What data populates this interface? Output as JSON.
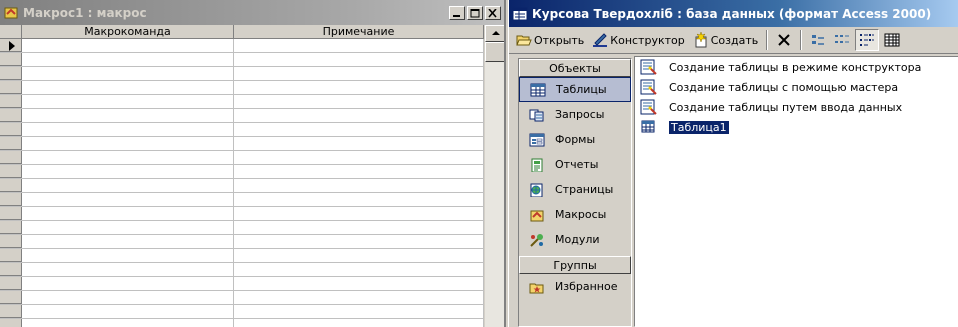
{
  "macro_window": {
    "title": "Макрос1 : макрос",
    "columns": [
      "Макрокоманда",
      "Примечание"
    ],
    "row_count": 21,
    "current_row": 1
  },
  "db_window": {
    "title": "Курсова Твердохліб : база данных (формат Access 2000)",
    "toolbar": {
      "open": "Открыть",
      "design": "Конструктор",
      "create": "Создать"
    },
    "objects_header": "Объекты",
    "objects": [
      {
        "label": "Таблицы",
        "icon": "tables-icon"
      },
      {
        "label": "Запросы",
        "icon": "queries-icon"
      },
      {
        "label": "Формы",
        "icon": "forms-icon"
      },
      {
        "label": "Отчеты",
        "icon": "reports-icon"
      },
      {
        "label": "Страницы",
        "icon": "pages-icon"
      },
      {
        "label": "Макросы",
        "icon": "macros-icon"
      },
      {
        "label": "Модули",
        "icon": "modules-icon"
      }
    ],
    "groups_header": "Группы",
    "groups": [
      {
        "label": "Избранное",
        "icon": "favorites-icon"
      }
    ],
    "items": [
      {
        "label": "Создание таблицы в режиме конструктора"
      },
      {
        "label": "Создание таблицы с помощью мастера"
      },
      {
        "label": "Создание таблицы путем ввода данных"
      },
      {
        "label": "Таблица1"
      }
    ],
    "selected_object": "Таблицы",
    "selected_item": "Таблица1"
  }
}
